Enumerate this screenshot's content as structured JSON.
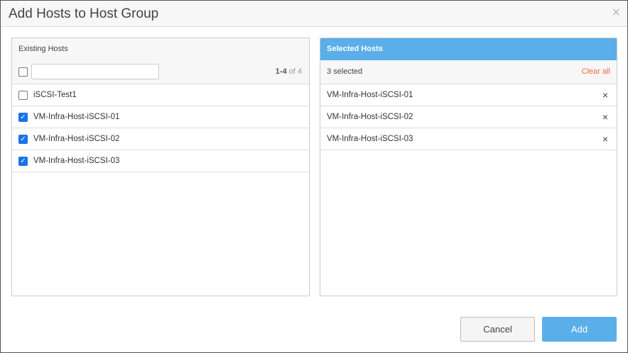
{
  "dialog": {
    "title": "Add Hosts to Host Group",
    "close": "×"
  },
  "existing": {
    "title": "Existing Hosts",
    "range": "1-4",
    "of": "of 4",
    "filter_value": "",
    "items": [
      {
        "label": "iSCSI-Test1",
        "checked": false
      },
      {
        "label": "VM-Infra-Host-iSCSI-01",
        "checked": true
      },
      {
        "label": "VM-Infra-Host-iSCSI-02",
        "checked": true
      },
      {
        "label": "VM-Infra-Host-iSCSI-03",
        "checked": true
      }
    ]
  },
  "selected": {
    "title": "Selected Hosts",
    "count": "3 selected",
    "clear": "Clear all",
    "remove": "×",
    "items": [
      "VM-Infra-Host-iSCSI-01",
      "VM-Infra-Host-iSCSI-02",
      "VM-Infra-Host-iSCSI-03"
    ]
  },
  "buttons": {
    "cancel": "Cancel",
    "add": "Add"
  }
}
